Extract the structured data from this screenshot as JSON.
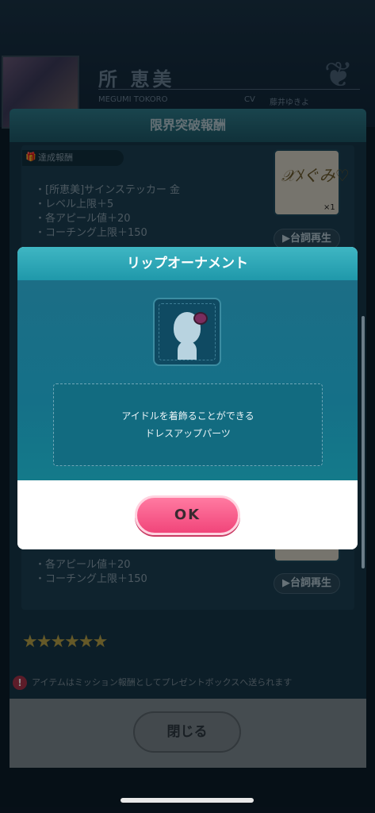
{
  "header": {
    "character_name": "所 恵美",
    "character_romaji": "MEGUMI TOKORO",
    "cv_label": "CV",
    "cv_name": "藤井ゆきよ"
  },
  "panel": {
    "title": "限界突破報酬",
    "tag_label": "達成報酬",
    "rewards": [
      "・[所恵美]サインステッカー 金",
      "・レベル上限＋5",
      "・各アピール値＋20",
      "・コーチング上限＋150"
    ],
    "item_count": "×1",
    "play_voice_label": "▶台詞再生",
    "rewards_lower": [
      "・各アピール値＋20",
      "・コーチング上限＋150"
    ],
    "play_voice_label_lower": "▶台詞再生",
    "stars": "★★★★★★",
    "notice": "アイテムはミッション報酬としてプレゼントボックスへ送られます",
    "close_label": "閉じる"
  },
  "modal": {
    "title": "リップオーナメント",
    "description_line1": "アイドルを着飾ることができる",
    "description_line2": "ドレスアップパーツ",
    "ok_label": "OK"
  },
  "colors": {
    "modal_header": "#2aa9b8",
    "ok_button": "#f1457a",
    "panel_bg": "#17384a"
  }
}
